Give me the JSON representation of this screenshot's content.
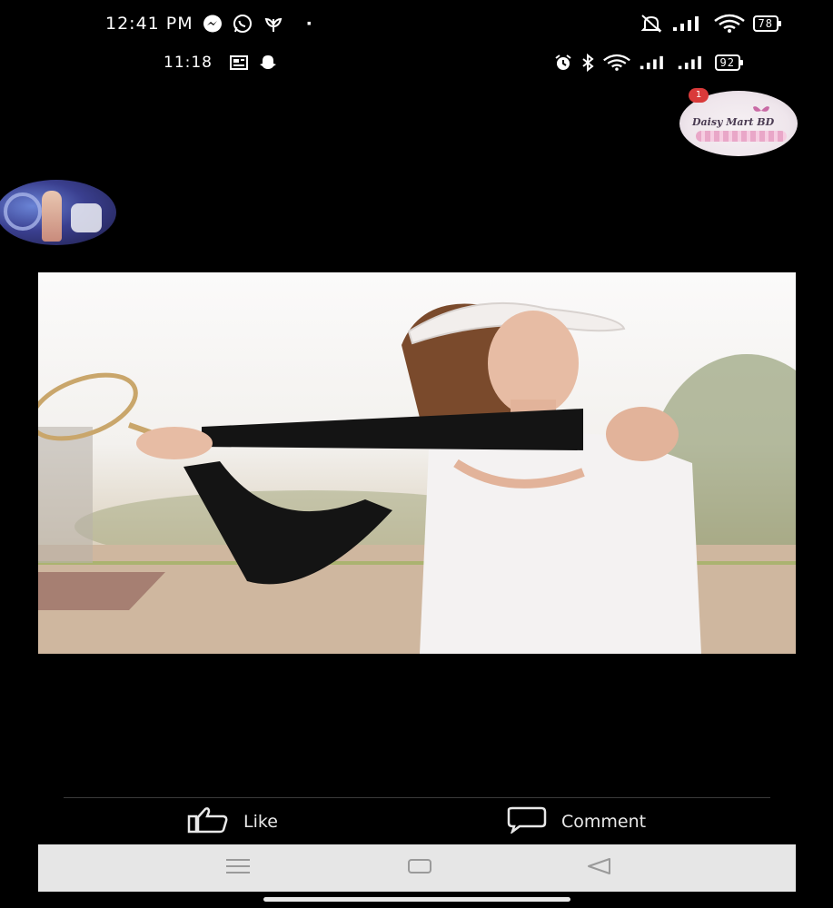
{
  "status_outer": {
    "time": "12:41 PM",
    "left_icons": [
      "messenger-icon",
      "whatsapp-icon",
      "leaf-icon"
    ],
    "dot": "·",
    "right_icons": [
      "mute-bell-icon",
      "signal-icon",
      "wifi-icon"
    ],
    "battery": "78"
  },
  "status_inner": {
    "time": "11:18",
    "left_icons": [
      "news-icon",
      "snapchat-icon"
    ],
    "right_icons": [
      "alarm-icon",
      "bluetooth-icon",
      "wifi-icon",
      "signal-icon",
      "signal-icon"
    ],
    "battery": "92"
  },
  "avatars": {
    "right": {
      "brand_text": "Daisy Mart BD",
      "badge": "1"
    },
    "left": {
      "icon": "profile-photo"
    }
  },
  "post": {
    "photo": "woman-playing-tennis-arm-sleeves"
  },
  "actions": {
    "like_label": "Like",
    "comment_label": "Comment"
  },
  "colors": {
    "background": "#000000",
    "navbar": "#e6e6e6",
    "badge": "#d93a3a"
  }
}
